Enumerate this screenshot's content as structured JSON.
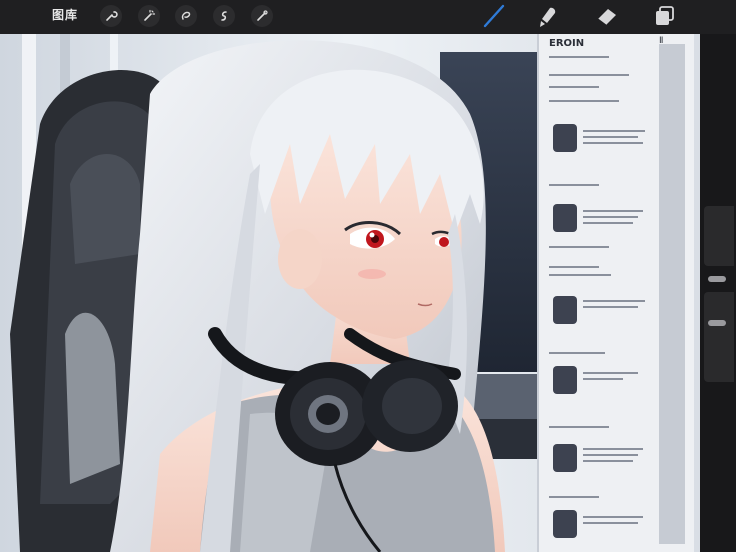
{
  "toolbar": {
    "gallery_label": "图库",
    "left_tools": [
      "wrench-icon",
      "magic-wand-icon",
      "selection-icon",
      "transform-icon",
      "brush-adjust-icon"
    ],
    "right_tools": [
      "brush-icon",
      "smudge-icon",
      "eraser-icon",
      "layers-icon"
    ],
    "accent_color": "#2f7bd8"
  },
  "document": {
    "header": "EROIN",
    "corner_mark": "Ⅱ"
  }
}
